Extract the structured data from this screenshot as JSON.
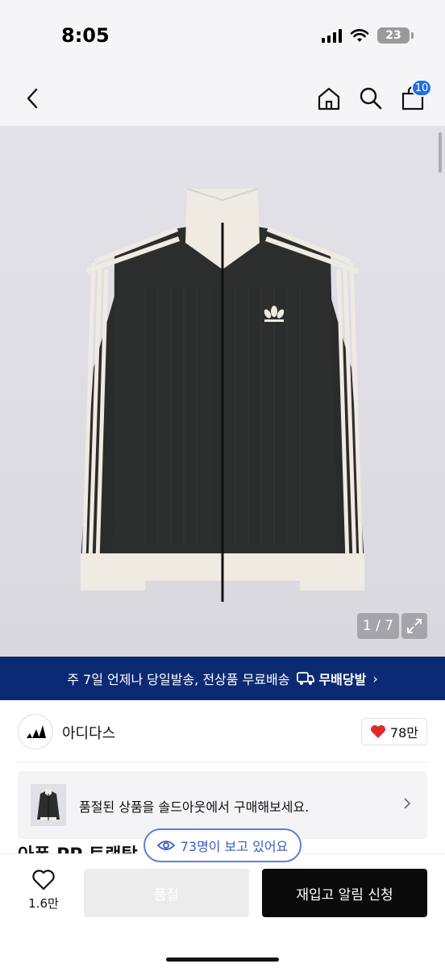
{
  "status": {
    "time": "8:05",
    "battery": "23",
    "signal_icon": "signal-icon",
    "wifi_icon": "wifi-icon"
  },
  "nav": {
    "back_icon": "chevron-left-icon",
    "home_icon": "home-icon",
    "search_icon": "search-icon",
    "cart_icon": "cart-icon",
    "cart_count": "10"
  },
  "gallery": {
    "page_indicator": "1 / 7",
    "expand_icon": "expand-icon",
    "current_page": 1,
    "total_pages": 7
  },
  "promo": {
    "text": "주 7일 언제나 당일발송, 전상품 무료배송",
    "brand": "무배당발",
    "chevron": "›"
  },
  "brand": {
    "name": "아디다스",
    "likes": "78만",
    "like_icon": "heart-filled-icon"
  },
  "soldout_card": {
    "text": "품절된 상품을 솔드아웃에서 구매해보세요.",
    "arrow_icon": "chevron-right-icon"
  },
  "product": {
    "title_partial": "아폰 PP 트랙탑"
  },
  "viewers": {
    "text": "73명이 보고 있어요",
    "icon": "eye-icon"
  },
  "bottom_bar": {
    "wish_count": "1.6만",
    "wish_icon": "heart-outline-icon",
    "soldout_label": "품절",
    "restock_label": "재입고 알림 신청"
  },
  "colors": {
    "promo_bg": "#0c2a74",
    "badge_blue": "#1f6fe0",
    "heart_red": "#e02a2a",
    "primary_button": "#0a0a0a",
    "disabled_button": "#ececec"
  }
}
